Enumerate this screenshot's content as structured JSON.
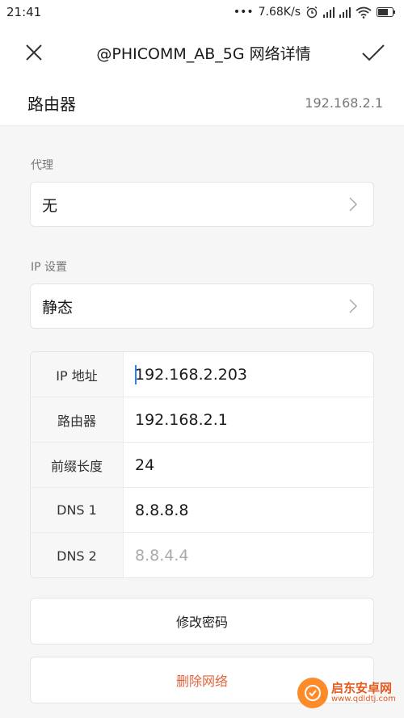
{
  "status_bar": {
    "time": "21:41",
    "dots": "•••",
    "speed": "7.68K/s"
  },
  "header": {
    "title": "@PHICOMM_AB_5G  网络详情",
    "close_icon": "close-icon",
    "confirm_icon": "check-icon"
  },
  "router": {
    "label": "路由器",
    "value": "192.168.2.1"
  },
  "proxy": {
    "section_label": "代理",
    "value": "无"
  },
  "ip_settings": {
    "section_label": "IP 设置",
    "value": "静态"
  },
  "ip_table": [
    {
      "key": "IP 地址",
      "value": "192.168.2.203",
      "is_hint": false
    },
    {
      "key": "路由器",
      "value": "192.168.2.1",
      "is_hint": false
    },
    {
      "key": "前缀长度",
      "value": "24",
      "is_hint": false
    },
    {
      "key": "DNS 1",
      "value": "8.8.8.8",
      "is_hint": false
    },
    {
      "key": "DNS 2",
      "value": "8.8.4.4",
      "is_hint": true
    }
  ],
  "actions": {
    "modify_password": "修改密码",
    "delete_network": "删除网络"
  },
  "watermark": {
    "name": "启东安卓网",
    "url": "www.qdldtj.com"
  },
  "colors": {
    "danger": "#e0643c",
    "cursor": "#2a7fff",
    "accent_orange": "#ff8a2a"
  }
}
